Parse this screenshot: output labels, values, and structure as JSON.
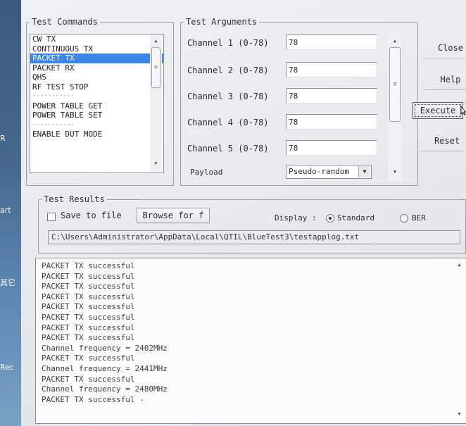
{
  "desktop": {
    "labels": [
      "R",
      "art",
      "其它",
      "Rec"
    ]
  },
  "test_commands": {
    "legend": "Test Commands",
    "items": [
      {
        "label": "CW TX",
        "selected": false
      },
      {
        "label": "CONTINUOUS TX",
        "selected": false
      },
      {
        "label": "PACKET TX",
        "selected": true
      },
      {
        "label": "PACKET RX",
        "selected": false
      },
      {
        "label": "QHS",
        "selected": false
      },
      {
        "label": "RF TEST STOP",
        "selected": false
      },
      {
        "label": "-----------",
        "selected": false
      },
      {
        "label": "POWER TABLE GET",
        "selected": false
      },
      {
        "label": "POWER TABLE SET",
        "selected": false
      },
      {
        "label": "-----------",
        "selected": false
      },
      {
        "label": "ENABLE DUT MODE",
        "selected": false
      }
    ]
  },
  "test_arguments": {
    "legend": "Test Arguments",
    "channels": [
      {
        "label": "Channel 1 (0-78)",
        "value": "78"
      },
      {
        "label": "Channel 2 (0-78)",
        "value": "78"
      },
      {
        "label": "Channel 3 (0-78)",
        "value": "78"
      },
      {
        "label": "Channel 4 (0-78)",
        "value": "78"
      },
      {
        "label": "Channel 5 (0-78)",
        "value": "78"
      }
    ],
    "payload": {
      "label": "Payload",
      "value": "Pseudo-random"
    }
  },
  "buttons": {
    "close": "Close",
    "help": "Help",
    "execute": "Execute",
    "reset": "Reset"
  },
  "test_results": {
    "legend": "Test Results",
    "save_to_file": "Save to file",
    "save_checked": false,
    "browse": "Browse for f",
    "display_label": "Display :",
    "display_options": [
      {
        "label": "Standard",
        "selected": true
      },
      {
        "label": "BER",
        "selected": false
      }
    ],
    "log_path": "C:\\Users\\Administrator\\AppData\\Local\\QTIL\\BlueTest3\\testapplog.txt",
    "log_lines": [
      "PACKET TX successful",
      "PACKET TX successful",
      "PACKET TX successful",
      "PACKET TX successful",
      "PACKET TX successful",
      "PACKET TX successful",
      "PACKET TX successful",
      "PACKET TX successful",
      "Channel frequency = 2402MHz",
      "PACKET TX successful",
      "Channel frequency = 2441MHz",
      "PACKET TX successful",
      "Channel frequency = 2480MHz",
      "PACKET TX successful -"
    ]
  },
  "colors": {
    "selection": "#3d86e8",
    "dialog_bg": "#e6e8ec",
    "desktop_bg": "#46698f"
  }
}
